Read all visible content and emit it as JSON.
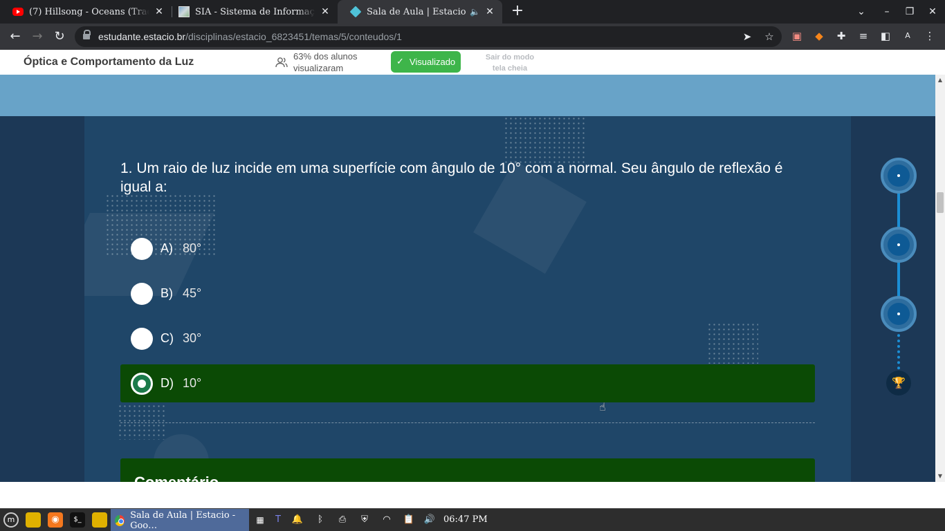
{
  "browser": {
    "tabs": [
      {
        "title": "(7) Hillsong - Oceans (Tradução / ",
        "icon": "youtube-icon"
      },
      {
        "title": "SIA - Sistema de Informações Ac",
        "icon": "sia-icon"
      },
      {
        "title": "Sala de Aula | Estacio",
        "icon": "estacio-icon",
        "active": true,
        "audio": true
      }
    ],
    "url_host": "estudante.estacio.br",
    "url_path": "/disciplinas/estacio_6823451/temas/5/conteudos/1"
  },
  "page": {
    "course_title": "Óptica e Comportamento da Luz",
    "views_text": "63% dos alunos visualizaram",
    "visualizado_label": "Visualizado",
    "exit_fullscreen_label": "Sair do modo tela cheia",
    "question": {
      "text": "1. Um raio de luz incide em uma superfície com ângulo de 10° com a normal. Seu ângulo de reflexão é igual a:",
      "options": [
        {
          "letter": "A)",
          "text": "80°",
          "selected": false
        },
        {
          "letter": "B)",
          "text": "45°",
          "selected": false
        },
        {
          "letter": "C)",
          "text": "30°",
          "selected": false
        },
        {
          "letter": "D)",
          "text": "10°",
          "selected": true
        }
      ]
    },
    "comment_title": "Comentário"
  },
  "colors": {
    "banner": "#68a3c8",
    "content_bg": "#1f4668",
    "selected_option": "#0b4a05",
    "visualizado": "#3eb54a"
  },
  "taskbar": {
    "window_title": "Sala de Aula | Estacio - Goo…",
    "clock": "06:47 PM"
  }
}
